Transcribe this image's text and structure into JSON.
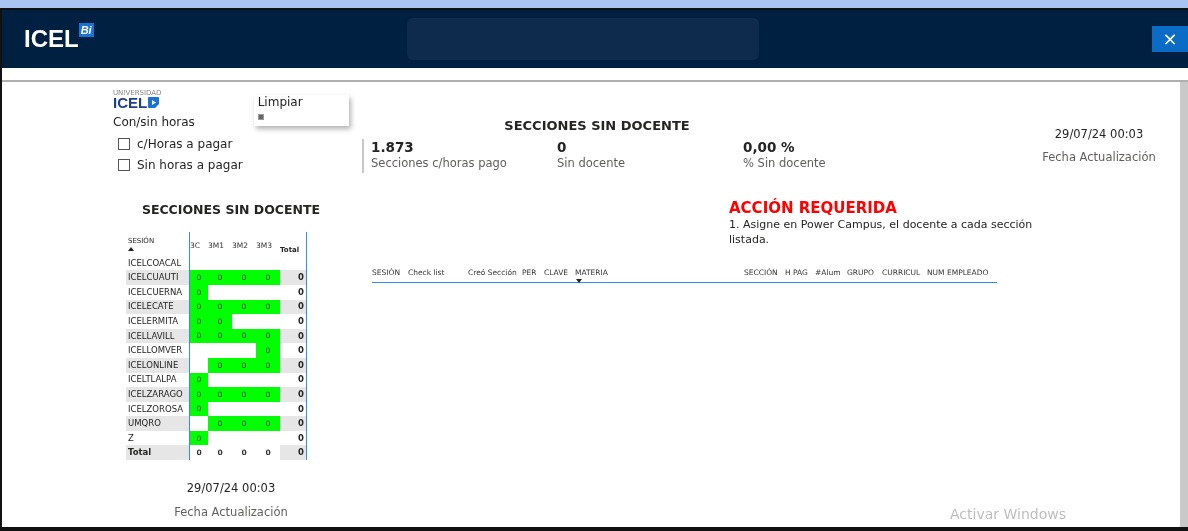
{
  "header": {
    "brand": "ICEL",
    "brand_badge": "Bi"
  },
  "close_button": {
    "label": "×"
  },
  "logo": {
    "small": "UNIVERSIDAD",
    "name": "ICEL"
  },
  "filter": {
    "title": "Con/sin horas",
    "options": [
      {
        "label": "c/Horas a pagar",
        "checked": false
      },
      {
        "label": "Sin horas a pagar",
        "checked": false
      }
    ]
  },
  "clear_button": {
    "label": "Limpiar"
  },
  "matrix": {
    "title": "SECCIONES SIN DOCENTE",
    "columns": [
      {
        "label": "SESIÓN",
        "sorted": true,
        "descending": false
      },
      {
        "label": "3C",
        "sorted": false
      },
      {
        "label": "3M1",
        "sorted": false
      },
      {
        "label": "3M2",
        "sorted": false
      },
      {
        "label": "3M3",
        "sorted": false
      },
      {
        "label": "Total",
        "sorted": false
      }
    ],
    "rows": [
      {
        "cells": [
          {
            "kind": "label",
            "value": "ICELCOACAL"
          },
          {
            "kind": "count",
            "filled": false
          },
          {
            "kind": "count",
            "filled": false
          },
          {
            "kind": "count",
            "filled": false
          },
          {
            "kind": "count",
            "filled": false
          }
        ]
      },
      {
        "cells": [
          {
            "kind": "label",
            "value": "ICELCUAUTI"
          },
          {
            "kind": "count",
            "filled": true,
            "value": "0"
          },
          {
            "kind": "count",
            "filled": true,
            "value": "0"
          },
          {
            "kind": "count",
            "filled": true,
            "value": "0"
          },
          {
            "kind": "count",
            "filled": true,
            "value": "0"
          },
          {
            "kind": "total",
            "value": "0"
          }
        ]
      },
      {
        "cells": [
          {
            "kind": "label",
            "value": "ICELCUERNA"
          },
          {
            "kind": "count",
            "filled": true,
            "value": "0"
          },
          {
            "kind": "count",
            "filled": false
          },
          {
            "kind": "count",
            "filled": false
          },
          {
            "kind": "count",
            "filled": false
          },
          {
            "kind": "total",
            "value": "0"
          }
        ]
      },
      {
        "cells": [
          {
            "kind": "label",
            "value": "ICELECATE"
          },
          {
            "kind": "count",
            "filled": true,
            "value": "0"
          },
          {
            "kind": "count",
            "filled": true,
            "value": "0"
          },
          {
            "kind": "count",
            "filled": true,
            "value": "0"
          },
          {
            "kind": "count",
            "filled": true,
            "value": "0"
          },
          {
            "kind": "total",
            "value": "0"
          }
        ]
      },
      {
        "cells": [
          {
            "kind": "label",
            "value": "ICELERMITA"
          },
          {
            "kind": "count",
            "filled": true,
            "value": "0"
          },
          {
            "kind": "count",
            "filled": true,
            "value": "0"
          },
          {
            "kind": "count",
            "filled": false
          },
          {
            "kind": "count",
            "filled": false
          },
          {
            "kind": "total",
            "value": "0"
          }
        ]
      },
      {
        "cells": [
          {
            "kind": "label",
            "value": "ICELLAVILL"
          },
          {
            "kind": "count",
            "filled": true,
            "value": "0"
          },
          {
            "kind": "count",
            "filled": true,
            "value": "0"
          },
          {
            "kind": "count",
            "filled": true,
            "value": "0"
          },
          {
            "kind": "count",
            "filled": true,
            "value": "0"
          },
          {
            "kind": "total",
            "value": "0"
          }
        ]
      },
      {
        "cells": [
          {
            "kind": "label",
            "value": "ICELLOMVER"
          },
          {
            "kind": "count",
            "filled": false
          },
          {
            "kind": "count",
            "filled": false
          },
          {
            "kind": "count",
            "filled": false
          },
          {
            "kind": "count",
            "filled": true,
            "value": "0"
          },
          {
            "kind": "total",
            "value": "0"
          }
        ]
      },
      {
        "cells": [
          {
            "kind": "label",
            "value": "ICELONLINE"
          },
          {
            "kind": "count",
            "filled": false
          },
          {
            "kind": "count",
            "filled": true,
            "value": "0"
          },
          {
            "kind": "count",
            "filled": true,
            "value": "0"
          },
          {
            "kind": "count",
            "filled": true,
            "value": "0"
          },
          {
            "kind": "total",
            "value": "0"
          }
        ]
      },
      {
        "cells": [
          {
            "kind": "label",
            "value": "ICELTLALPA"
          },
          {
            "kind": "count",
            "filled": true,
            "value": "0"
          },
          {
            "kind": "count",
            "filled": false
          },
          {
            "kind": "count",
            "filled": false
          },
          {
            "kind": "count",
            "filled": false
          },
          {
            "kind": "total",
            "value": "0"
          }
        ]
      },
      {
        "cells": [
          {
            "kind": "label",
            "value": "ICELZARAGO"
          },
          {
            "kind": "count",
            "filled": true,
            "value": "0"
          },
          {
            "kind": "count",
            "filled": true,
            "value": "0"
          },
          {
            "kind": "count",
            "filled": true,
            "value": "0"
          },
          {
            "kind": "count",
            "filled": true,
            "value": "0"
          },
          {
            "kind": "total",
            "value": "0"
          }
        ]
      },
      {
        "cells": [
          {
            "kind": "label",
            "value": "ICELZOROSA"
          },
          {
            "kind": "count",
            "filled": true,
            "value": "0"
          },
          {
            "kind": "count",
            "filled": false
          },
          {
            "kind": "count",
            "filled": false
          },
          {
            "kind": "count",
            "filled": false
          },
          {
            "kind": "total",
            "value": "0"
          }
        ]
      },
      {
        "cells": [
          {
            "kind": "label",
            "value": "UMQRO"
          },
          {
            "kind": "count",
            "filled": false
          },
          {
            "kind": "count",
            "filled": true,
            "value": "0"
          },
          {
            "kind": "count",
            "filled": true,
            "value": "0"
          },
          {
            "kind": "count",
            "filled": true,
            "value": "0"
          },
          {
            "kind": "total",
            "value": "0"
          }
        ]
      },
      {
        "cells": [
          {
            "kind": "label",
            "value": "Z"
          },
          {
            "kind": "count",
            "filled": true,
            "value": "0"
          },
          {
            "kind": "count",
            "filled": false
          },
          {
            "kind": "count",
            "filled": false
          },
          {
            "kind": "count",
            "filled": false
          },
          {
            "kind": "total",
            "value": "0"
          }
        ]
      },
      {
        "cells": [
          {
            "kind": "total_label",
            "value": "Total"
          },
          {
            "kind": "total",
            "value": "0"
          },
          {
            "kind": "total",
            "value": "0"
          },
          {
            "kind": "total",
            "value": "0"
          },
          {
            "kind": "total",
            "value": "0"
          },
          {
            "kind": "total",
            "value": "0"
          }
        ]
      }
    ]
  },
  "left_update": {
    "date": "29/07/24 00:03",
    "label": "Fecha Actualización"
  },
  "summary": {
    "title": "SECCIONES SIN DOCENTE",
    "kpis": [
      {
        "value": "1.873",
        "label": "Secciones c/horas pago"
      },
      {
        "value": "0",
        "label": "Sin docente"
      },
      {
        "value": "0,00 %",
        "label": "% Sin docente"
      }
    ]
  },
  "right_update": {
    "date": "29/07/24 00:03",
    "label": "Fecha Actualización"
  },
  "action": {
    "title": "ACCIÓN REQUERIDA",
    "text": "1. Asigne en Power Campus, el docente a cada sección listada."
  },
  "table": {
    "columns": [
      {
        "label": "SESIÓN",
        "sorted": false
      },
      {
        "label": "Check list",
        "sorted": false
      },
      {
        "label": "Creó Sección",
        "sorted": false
      },
      {
        "label": "PER",
        "sorted": false
      },
      {
        "label": "CLAVE",
        "sorted": false
      },
      {
        "label": "MATERIA",
        "sorted": true,
        "descending": true
      },
      {
        "label": "SECCIÓN",
        "sorted": false
      },
      {
        "label": "H PAG",
        "sorted": false
      },
      {
        "label": "#Alum",
        "sorted": false
      },
      {
        "label": "GRUPO",
        "sorted": false
      },
      {
        "label": "CURRICUL",
        "sorted": false
      },
      {
        "label": "NUM EMPLEADO",
        "sorted": false
      }
    ]
  },
  "watermark_os": {
    "text": "Activar Windows"
  }
}
